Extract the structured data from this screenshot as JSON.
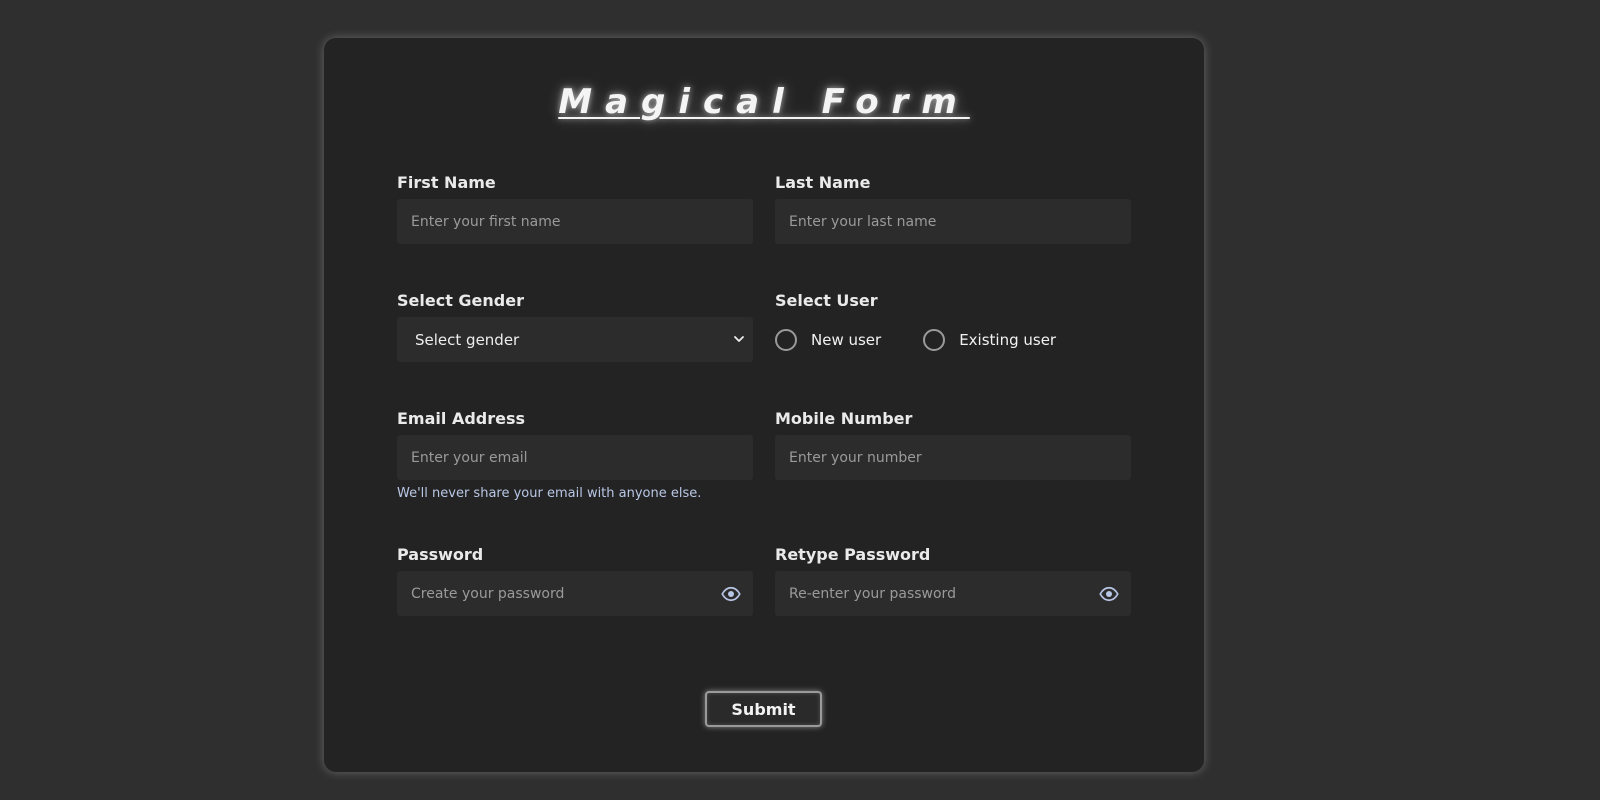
{
  "form": {
    "title": "Magical Form",
    "first_name": {
      "label": "First Name",
      "placeholder": "Enter your first name"
    },
    "last_name": {
      "label": "Last Name",
      "placeholder": "Enter your last name"
    },
    "gender": {
      "label": "Select Gender",
      "selected": "Select gender"
    },
    "user": {
      "label": "Select User",
      "options": [
        "New user",
        "Existing user"
      ]
    },
    "email": {
      "label": "Email Address",
      "placeholder": "Enter your email",
      "help": "We'll never share your email with anyone else."
    },
    "mobile": {
      "label": "Mobile Number",
      "placeholder": "Enter your number"
    },
    "password": {
      "label": "Password",
      "placeholder": "Create your password",
      "toggle_icon": "eye-icon"
    },
    "retype_password": {
      "label": "Retype Password",
      "placeholder": "Re-enter your password",
      "toggle_icon": "eye-icon"
    },
    "submit_label": "Submit"
  },
  "colors": {
    "page_bg": "#2f2f2f",
    "card_bg": "#232323",
    "input_bg": "#2c2c2c",
    "help_text": "#b9c7e6",
    "eye_icon": "#b9c7e6"
  }
}
